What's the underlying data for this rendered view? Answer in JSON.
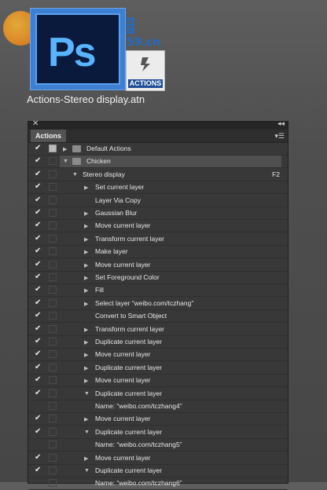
{
  "top": {
    "badge_label": "ACTIONS",
    "ps_label": "Ps",
    "filename": "Actions-Stereo display.atn",
    "watermark_title": "河东软件园",
    "watermark_url": "www.pc0359.cn"
  },
  "panel": {
    "tab": "Actions",
    "rows": [
      {
        "label": "Default Actions",
        "indent": 0,
        "type": "set",
        "expanded": false,
        "checked": true,
        "dialog": true
      },
      {
        "label": "Chicken",
        "indent": 0,
        "type": "set",
        "expanded": true,
        "checked": true,
        "dialog": false,
        "selected": true
      },
      {
        "label": "Stereo display",
        "indent": 1,
        "type": "action",
        "expanded": true,
        "checked": true,
        "key": "F2"
      },
      {
        "label": "Set current layer",
        "indent": 2,
        "type": "cmd",
        "expandable": true,
        "checked": true
      },
      {
        "label": "Layer Via Copy",
        "indent": 2,
        "type": "cmd",
        "expandable": false,
        "checked": true
      },
      {
        "label": "Gaussian Blur",
        "indent": 2,
        "type": "cmd",
        "expandable": true,
        "checked": true
      },
      {
        "label": "Move current layer",
        "indent": 2,
        "type": "cmd",
        "expandable": true,
        "checked": true
      },
      {
        "label": "Transform current layer",
        "indent": 2,
        "type": "cmd",
        "expandable": true,
        "checked": true
      },
      {
        "label": "Make layer",
        "indent": 2,
        "type": "cmd",
        "expandable": true,
        "checked": true
      },
      {
        "label": "Move current layer",
        "indent": 2,
        "type": "cmd",
        "expandable": true,
        "checked": true
      },
      {
        "label": "Set Foreground Color",
        "indent": 2,
        "type": "cmd",
        "expandable": true,
        "checked": true
      },
      {
        "label": "Fill",
        "indent": 2,
        "type": "cmd",
        "expandable": true,
        "checked": true
      },
      {
        "label": "Select layer “weibo.com/tczhang”",
        "indent": 2,
        "type": "cmd",
        "expandable": true,
        "checked": true
      },
      {
        "label": "Convert to Smart Object",
        "indent": 2,
        "type": "cmd",
        "expandable": false,
        "checked": true
      },
      {
        "label": "Transform current layer",
        "indent": 2,
        "type": "cmd",
        "expandable": true,
        "checked": true
      },
      {
        "label": "Duplicate current layer",
        "indent": 2,
        "type": "cmd",
        "expandable": true,
        "checked": true
      },
      {
        "label": "Move current layer",
        "indent": 2,
        "type": "cmd",
        "expandable": true,
        "checked": true
      },
      {
        "label": "Duplicate current layer",
        "indent": 2,
        "type": "cmd",
        "expandable": true,
        "checked": true
      },
      {
        "label": "Move current layer",
        "indent": 2,
        "type": "cmd",
        "expandable": true,
        "checked": true
      },
      {
        "label": "Duplicate current layer",
        "indent": 2,
        "type": "cmd",
        "expandable": true,
        "expanded": true,
        "checked": true
      },
      {
        "label": "Name:  “weibo.com/tczhang4”",
        "indent": 3,
        "type": "detail",
        "checked": false
      },
      {
        "label": "Move current layer",
        "indent": 2,
        "type": "cmd",
        "expandable": true,
        "checked": true
      },
      {
        "label": "Duplicate current layer",
        "indent": 2,
        "type": "cmd",
        "expandable": true,
        "expanded": true,
        "checked": true
      },
      {
        "label": "Name:  “weibo.com/tczhang5”",
        "indent": 3,
        "type": "detail",
        "checked": false
      },
      {
        "label": "Move current layer",
        "indent": 2,
        "type": "cmd",
        "expandable": true,
        "checked": true
      },
      {
        "label": "Duplicate current layer",
        "indent": 2,
        "type": "cmd",
        "expandable": true,
        "expanded": true,
        "checked": true
      },
      {
        "label": "Name:  “weibo.com/tczhang6”",
        "indent": 3,
        "type": "detail",
        "checked": false
      }
    ]
  }
}
